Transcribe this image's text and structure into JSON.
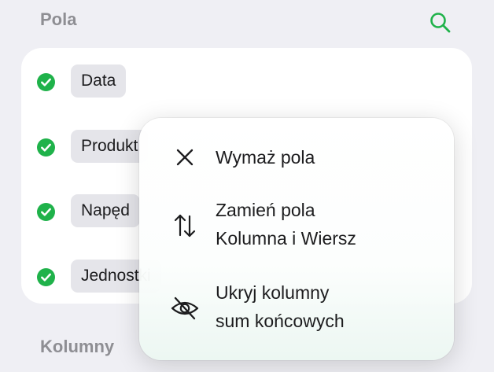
{
  "header": {
    "title": "Pola",
    "search_icon": "search-icon"
  },
  "fields": [
    {
      "label": "Data",
      "checked": true
    },
    {
      "label": "Produkt",
      "checked": true
    },
    {
      "label": "Napęd",
      "checked": true
    },
    {
      "label": "Jednostki",
      "checked": true
    }
  ],
  "footer": {
    "section_title": "Kolumny"
  },
  "context_menu": {
    "items": [
      {
        "icon": "xmark-icon",
        "line1": "Wymaż pola",
        "line2": ""
      },
      {
        "icon": "swap-arrows-icon",
        "line1": "Zamień pola",
        "line2": "Kolumna i Wiersz"
      },
      {
        "icon": "eye-slash-icon",
        "line1": "Ukryj kolumny",
        "line2": "sum końcowych"
      }
    ]
  },
  "colors": {
    "accent": "#1fb24a",
    "background": "#efeff4",
    "card": "#ffffff",
    "pill": "#e5e5ea",
    "secondary_text": "#8e8e93"
  }
}
